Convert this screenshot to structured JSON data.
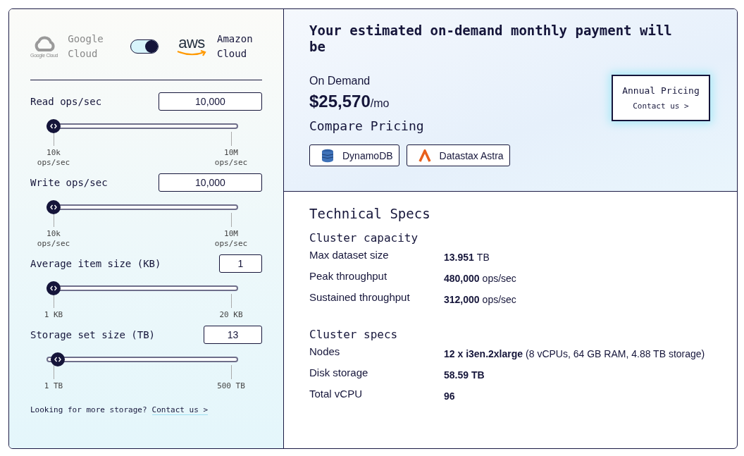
{
  "providers": [
    {
      "name": "Google Cloud",
      "logo_caption": "Google Cloud",
      "kind": "google",
      "selected": false
    },
    {
      "name": "Amazon Cloud",
      "logo_caption": "aws",
      "kind": "aws",
      "selected": true
    }
  ],
  "provider_toggle": {
    "on": true
  },
  "inputs": [
    {
      "label": "Read ops/sec",
      "value": "10,000",
      "level": 0,
      "min": "10k ops/sec",
      "max": "10M ops/sec"
    },
    {
      "label": "Write ops/sec",
      "value": "10,000",
      "level": 0,
      "min": "10k ops/sec",
      "max": "10M ops/sec"
    },
    {
      "label": "Average item size (KB)",
      "value": "1",
      "level": 0,
      "min": "1 KB",
      "max": "20 KB"
    },
    {
      "label": "Storage set size (TB)",
      "value": "13",
      "level": 0.025,
      "min": "1 TB",
      "max": "500 TB"
    }
  ],
  "storage_note": {
    "text": "Looking for more storage?",
    "link": "Contact us >"
  },
  "estimate": {
    "title": "Your estimated on-demand monthly payment will be",
    "plan": "On Demand",
    "price": "$25,570",
    "period": "/mo"
  },
  "annual": {
    "title": "Annual Pricing",
    "link": "Contact us >"
  },
  "compare": {
    "title": "Compare Pricing",
    "buttons": [
      {
        "label": "DynamoDB",
        "kind": "dynamodb"
      },
      {
        "label": "Datastax Astra",
        "kind": "astra"
      }
    ]
  },
  "specs": {
    "title": "Technical Specs",
    "sections": [
      {
        "title": "Cluster capacity",
        "rows": [
          {
            "label": "Max dataset size",
            "value": "13.951",
            "unit": "TB"
          },
          {
            "label": "Peak throughput",
            "value": "480,000",
            "unit": "ops/sec"
          },
          {
            "label": "Sustained throughput",
            "value": "312,000",
            "unit": "ops/sec"
          }
        ]
      },
      {
        "title": "Cluster specs",
        "rows": [
          {
            "label": "Nodes",
            "value": "12 x i3en.2xlarge",
            "unit": "(8 vCPUs, 64 GB RAM, 4.88 TB storage)"
          },
          {
            "label": "Disk storage",
            "value": "58.59 TB"
          },
          {
            "label": "Total vCPU",
            "value": "96"
          }
        ]
      }
    ]
  }
}
